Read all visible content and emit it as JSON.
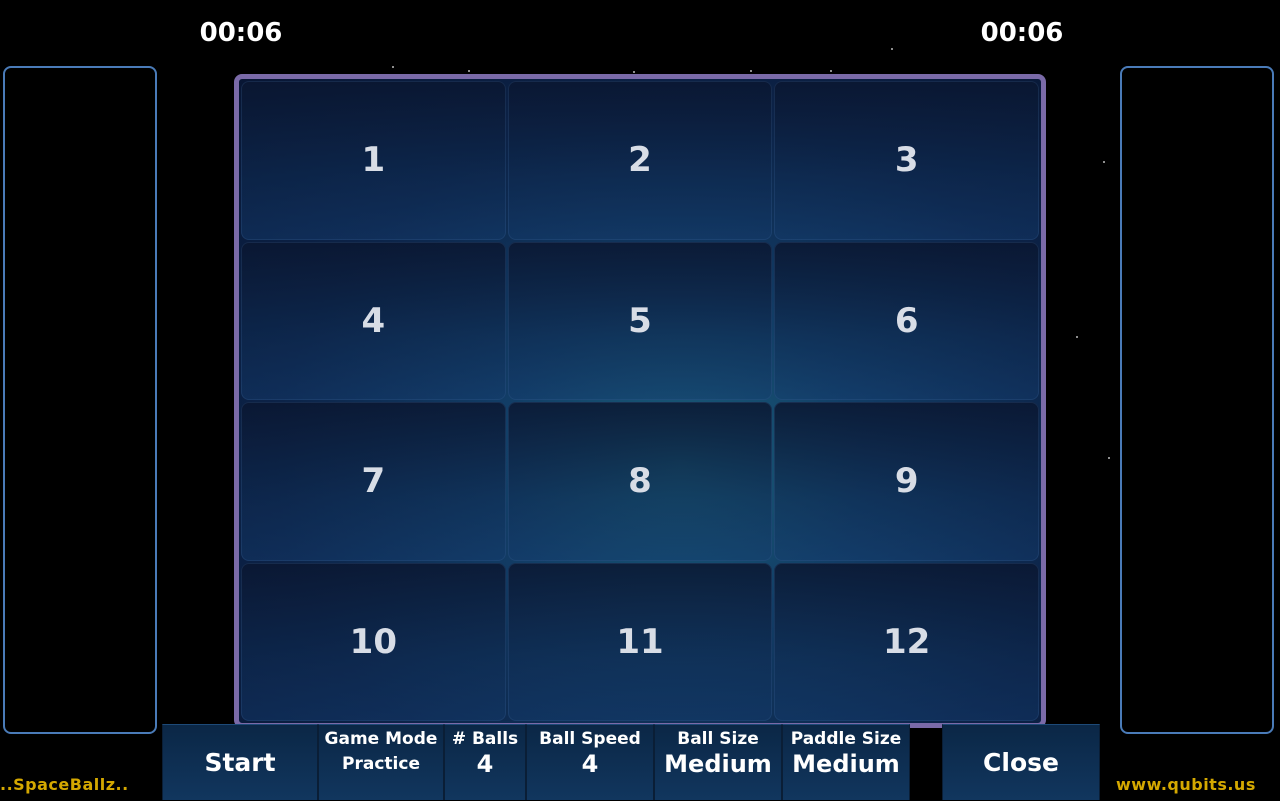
{
  "timers": {
    "left": "00:06",
    "right": "00:06"
  },
  "tiles": [
    "1",
    "2",
    "3",
    "4",
    "5",
    "6",
    "7",
    "8",
    "9",
    "10",
    "11",
    "12"
  ],
  "controls": {
    "start": "Start",
    "game_mode": {
      "label": "Game Mode",
      "value": "Practice"
    },
    "balls": {
      "label": "# Balls",
      "value": "4"
    },
    "ball_speed": {
      "label": "Ball Speed",
      "value": "4"
    },
    "ball_size": {
      "label": "Ball Size",
      "value": "Medium"
    },
    "paddle_size": {
      "label": "Paddle Size",
      "value": "Medium"
    },
    "close": "Close"
  },
  "footer": {
    "left": "..SpaceBallz..",
    "right": "www.qubits.us"
  },
  "colors": {
    "accent_text": "#d4a800",
    "panel_border": "#4a7bb8",
    "board_border": "#7a6aa8",
    "button_bg": "#0b2746"
  }
}
